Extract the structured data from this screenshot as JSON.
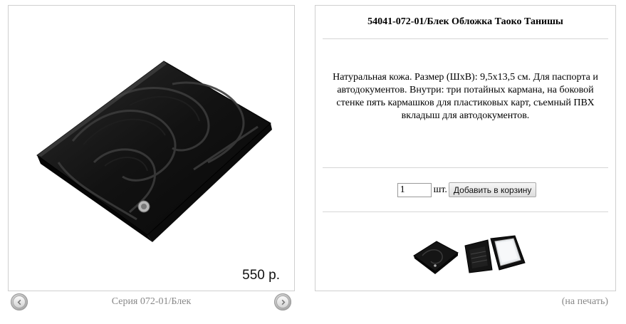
{
  "product": {
    "title": "54041-072-01/Блек Обложка Таоко Танишы",
    "description": "Натуральная кожа. Размер (ШхВ): 9,5х13,5 см. Для паспорта и автодокументов. Внутри: три потайных кармана, на боковой стенке пять кармашков для пластиковых карт, съемный ПВХ вкладыш для автодокументов.",
    "price": "550 р."
  },
  "gallery": {
    "series_label": "Серия 072-01/Блек",
    "prev_icon": "chevron-left-icon",
    "next_icon": "chevron-right-icon"
  },
  "order": {
    "quantity": "1",
    "unit": "шт.",
    "add_to_cart_label": "Добавить в корзину"
  },
  "print_label": "(на печать)"
}
